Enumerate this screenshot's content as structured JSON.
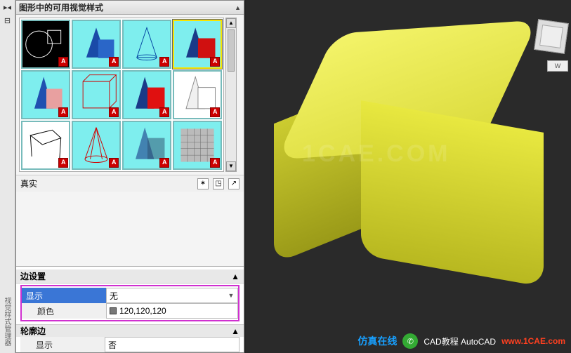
{
  "panel": {
    "title": "图形中的可用视觉样式",
    "section_label": "真实",
    "edge_header": "边设置",
    "outline_header": "轮廓边",
    "rows": {
      "show_label": "显示",
      "show_value": "无",
      "color_label": "颜色",
      "color_value": "120,120,120",
      "outline_show_label": "显示",
      "outline_show_value": "否"
    }
  },
  "viewport": {
    "wcs": "W"
  },
  "watermarks": {
    "center": "1CAE.COM",
    "brand1": "CAD教程 AutoCAD",
    "brand2": "仿真在线",
    "brand3": "www.1CAE.com"
  },
  "sidebar_label": "视觉样式管理器"
}
